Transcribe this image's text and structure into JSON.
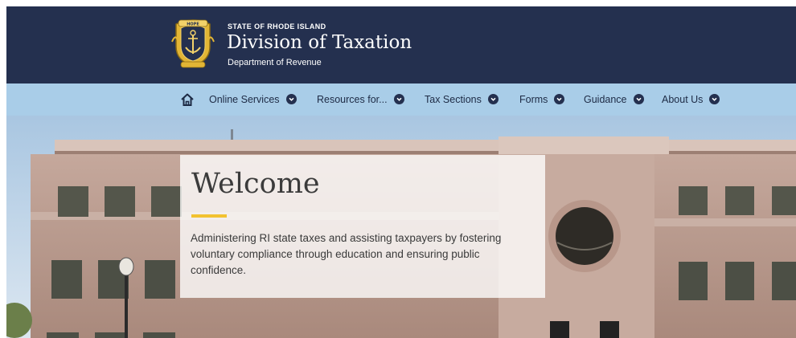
{
  "header": {
    "state_label": "STATE OF RHODE ISLAND",
    "title": "Division of Taxation",
    "subtitle": "Department of Revenue",
    "seal": {
      "icon": "anchor-seal-icon",
      "banner_text": "HOPE"
    }
  },
  "nav": {
    "home_icon": "home-icon",
    "items": [
      {
        "label": "Online Services"
      },
      {
        "label": "Resources for..."
      },
      {
        "label": "Tax Sections"
      },
      {
        "label": "Forms"
      },
      {
        "label": "Guidance"
      },
      {
        "label": "About Us"
      }
    ]
  },
  "hero": {
    "title": "Welcome",
    "text": "Administering RI state taxes and assisting taxpayers by fostering voluntary compliance through education and ensuring public confidence."
  },
  "colors": {
    "header_bg": "#24304f",
    "nav_bg": "#a9cde8",
    "accent": "#f2c230"
  }
}
